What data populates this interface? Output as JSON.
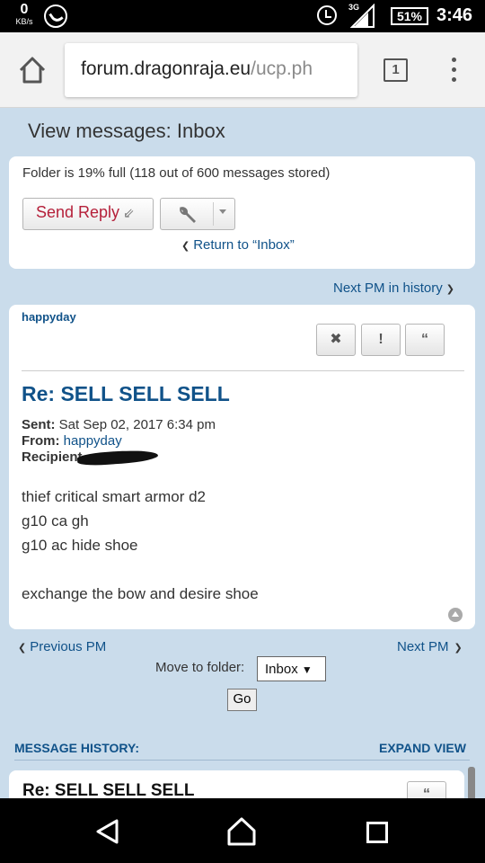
{
  "status_bar": {
    "kb_value": "0",
    "kb_unit": "KB/s",
    "network": "3G",
    "battery": "51%",
    "time": "3:46",
    "icons": [
      "whatsapp-icon",
      "alarm-icon",
      "signal-icon",
      "battery-icon"
    ]
  },
  "browser": {
    "url_domain": "forum.dragonraja.eu",
    "url_path": "/ucp.ph",
    "tab_count": "1"
  },
  "page": {
    "title": "View messages: Inbox",
    "folder_info": "Folder is 19% full (118 out of 600 messages stored)",
    "send_reply": "Send Reply",
    "return_link": "Return to “Inbox”",
    "next_in_history": "Next PM in history"
  },
  "message": {
    "author": "happyday",
    "title": "Re: SELL SELL SELL",
    "sent_label": "Sent:",
    "sent_value": "Sat Sep 02, 2017 6:34 pm",
    "from_label": "From:",
    "from_value": "happyday",
    "recipient_label": "Recipient",
    "body_lines": [
      "thief critical smart armor d2",
      "g10 ca gh",
      "g10 ac hide shoe",
      "",
      "exchange the bow and desire shoe"
    ],
    "action_delete": "✖",
    "action_report": "!",
    "action_quote": "“"
  },
  "footer_nav": {
    "prev_pm": "Previous PM",
    "next_pm": "Next PM",
    "move_label": "Move to folder:",
    "folder_selected": "Inbox",
    "go": "Go"
  },
  "history": {
    "label": "MESSAGE HISTORY:",
    "expand": "EXPAND VIEW",
    "first_title": "Re: SELL SELL SELL"
  }
}
